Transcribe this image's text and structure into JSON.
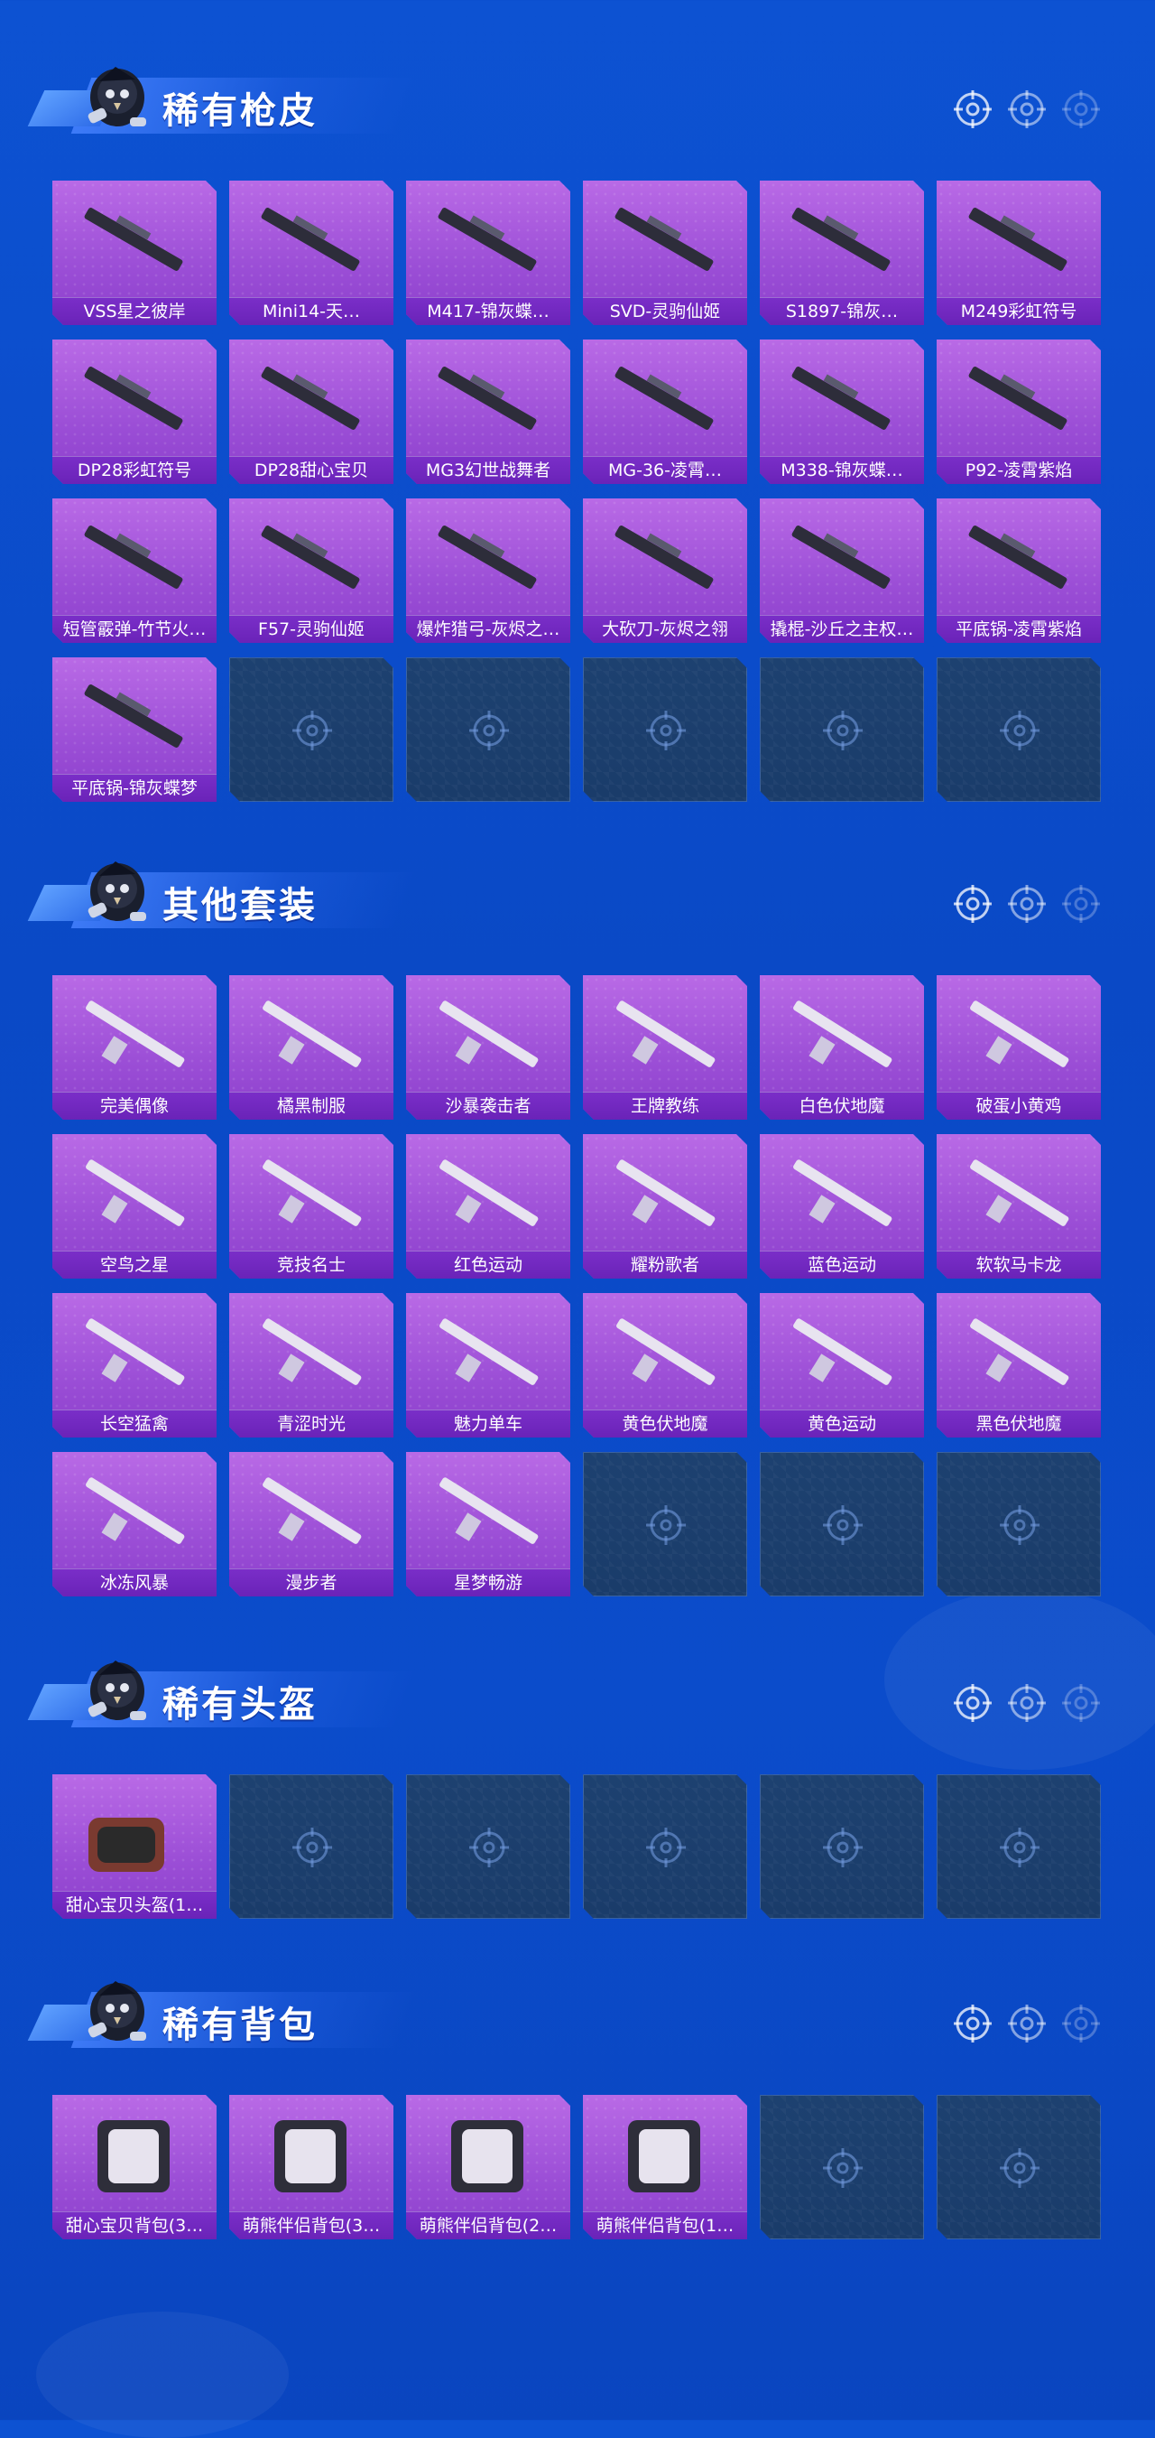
{
  "sections": [
    {
      "id": "rare-gun-skins",
      "title": "稀有枪皮",
      "items": [
        "VSS星之彼岸",
        "Mini14-天…",
        "M417-锦灰蝶…",
        "SVD-灵驹仙姬",
        "S1897-锦灰…",
        "M249彩虹符号",
        "DP28彩虹符号",
        "DP28甜心宝贝",
        "MG3幻世战舞者",
        "MG-36-凌霄…",
        "M338-锦灰蝶…",
        "P92-凌霄紫焰",
        "短管霰弹-竹节火…",
        "F57-灵驹仙姬",
        "爆炸猎弓-灰烬之…",
        "大砍刀-灰烬之翎",
        "撬棍-沙丘之主权…",
        "平底锅-凌霄紫焰",
        "平底锅-锦灰蝶梦"
      ],
      "empty_count": 5
    },
    {
      "id": "other-outfits",
      "title": "其他套装",
      "items": [
        "完美偶像",
        "橘黑制服",
        "沙暴袭击者",
        "王牌教练",
        "白色伏地魔",
        "破蛋小黄鸡",
        "空鸟之星",
        "竞技名士",
        "红色运动",
        "耀粉歌者",
        "蓝色运动",
        "软软马卡龙",
        "长空猛禽",
        "青涩时光",
        "魅力单车",
        "黄色伏地魔",
        "黄色运动",
        "黑色伏地魔",
        "冰冻风暴",
        "漫步者",
        "星梦畅游"
      ],
      "empty_count": 3
    },
    {
      "id": "rare-helmets",
      "title": "稀有头盔",
      "items": [
        "甜心宝贝头盔(1…"
      ],
      "empty_count": 5
    },
    {
      "id": "rare-backpacks",
      "title": "稀有背包",
      "items": [
        "甜心宝贝背包(3…",
        "萌熊伴侣背包(3…",
        "萌熊伴侣背包(2…",
        "萌熊伴侣背包(1…"
      ],
      "empty_count": 2
    }
  ],
  "colors": {
    "background": "#0d52d2",
    "tile_filled": "#a75adf",
    "tile_label": "#7a2ec8",
    "tile_empty": "#1d4170"
  },
  "icons": {
    "section_mascot": "chicken-mascot-icon",
    "section_ornament": "crosshair-icon",
    "empty_slot": "crosshair-icon"
  }
}
